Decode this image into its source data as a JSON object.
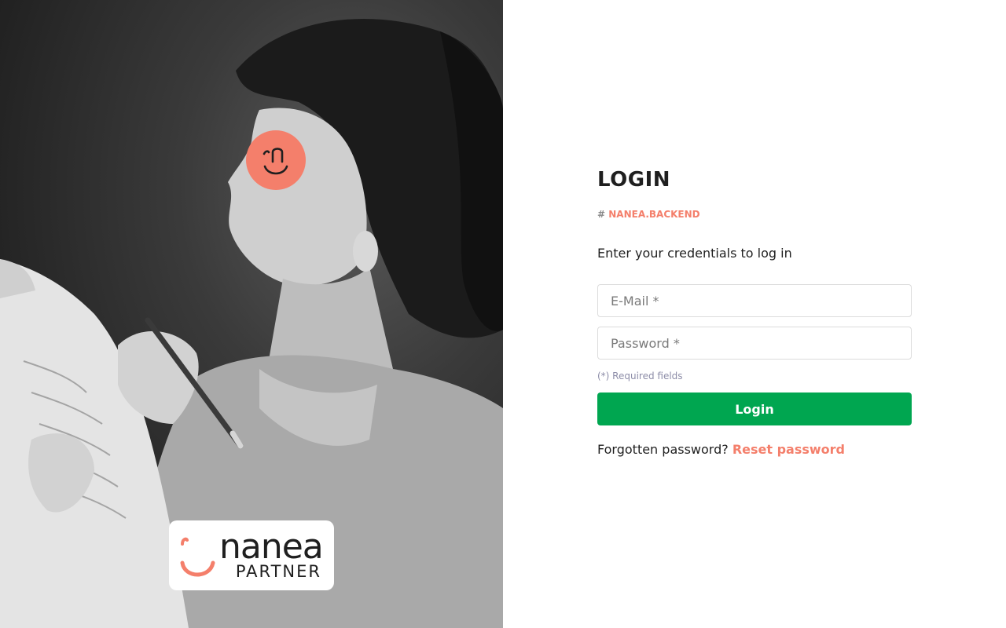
{
  "hero": {
    "badge_icon": "nanea-smile-icon",
    "logo": {
      "word": "nanea",
      "sub": "PARTNER",
      "accent": "#f47f6b"
    }
  },
  "form": {
    "title": "LOGIN",
    "tag_hash": "#",
    "tag_text": "NANEA.BACKEND",
    "intro": "Enter your credentials to log in",
    "email_placeholder": "E-Mail *",
    "password_placeholder": "Password *",
    "required_note": "(*) Required fields",
    "login_label": "Login",
    "forgot_text": "Forgotten password?",
    "reset_link": "Reset password"
  },
  "colors": {
    "accent": "#f47f6b",
    "primary_button": "#00a650"
  }
}
